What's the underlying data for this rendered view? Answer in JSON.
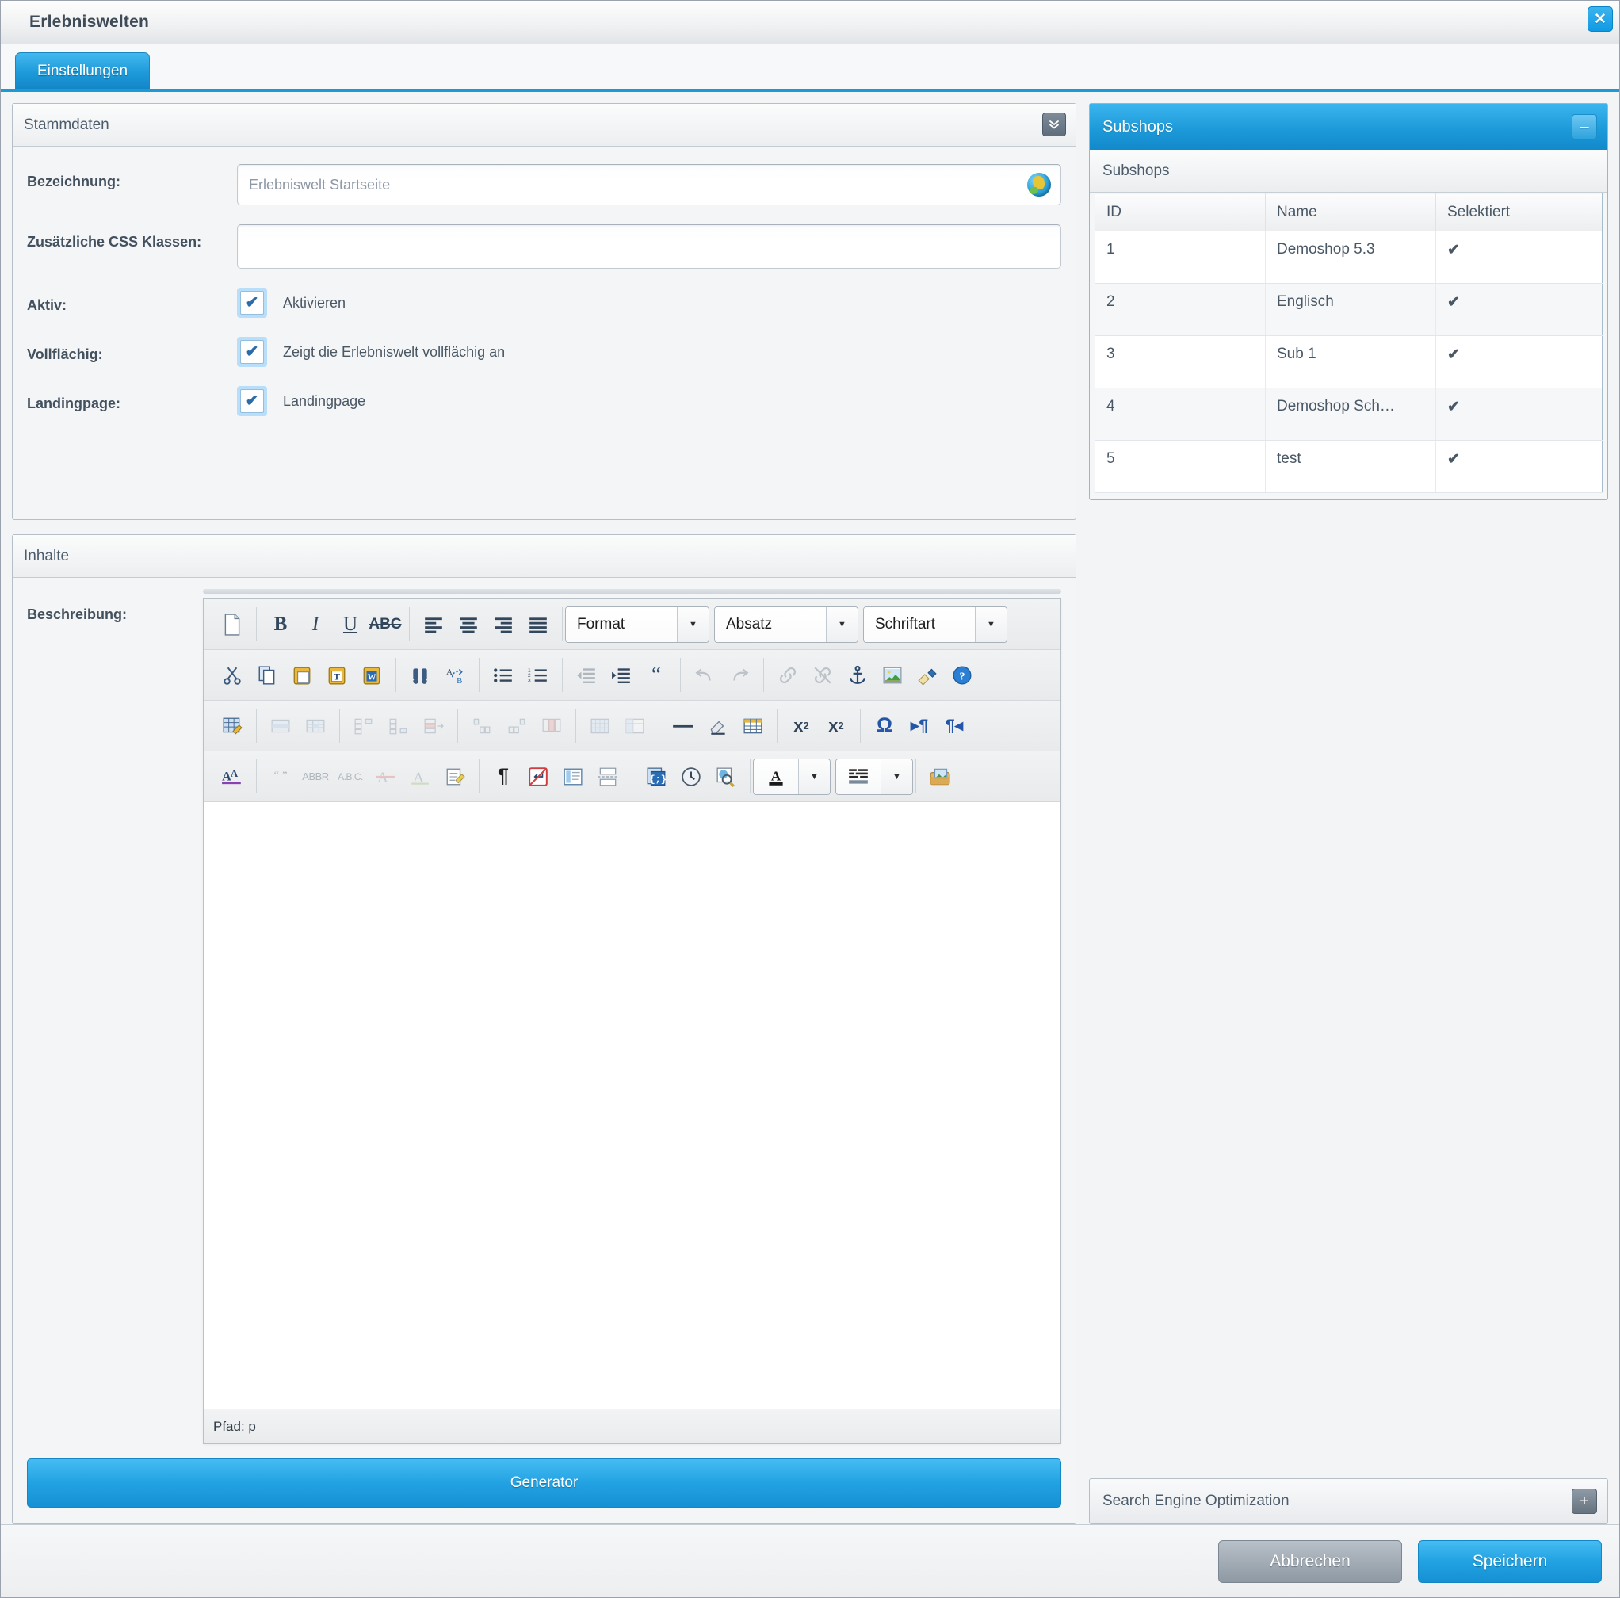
{
  "window": {
    "title": "Erlebniswelten",
    "close_icon": "close-icon"
  },
  "tabs": [
    {
      "label": "Einstellungen"
    }
  ],
  "stammdaten": {
    "header": "Stammdaten",
    "collapse_icon": "double-chevron-down-icon",
    "fields": {
      "bezeichnung_label": "Bezeichnung:",
      "bezeichnung_value": "Erlebniswelt Startseite",
      "css_label": "Zusätzliche CSS Klassen:",
      "css_value": "",
      "css_placeholder": "",
      "aktiv_label": "Aktiv:",
      "aktiv_checkbox_label": "Aktivieren",
      "vollflaechig_label": "Vollflächig:",
      "vollflaechig_checkbox_label": "Zeigt die Erlebniswelt vollflächig an",
      "landingpage_label": "Landingpage:",
      "landingpage_checkbox_label": "Landingpage",
      "check_glyph": "✔"
    }
  },
  "inhalte": {
    "header": "Inhalte",
    "beschreibung_label": "Beschreibung:",
    "editor": {
      "format_select": "Format",
      "absatz_select": "Absatz",
      "schriftart_select": "Schriftart",
      "status": "Pfad: p",
      "content": ""
    },
    "generator_button": "Generator"
  },
  "subshops": {
    "header": "Subshops",
    "collapse_icon": "minus-icon",
    "subheader": "Subshops",
    "columns": [
      "ID",
      "Name",
      "Selektiert"
    ],
    "rows": [
      {
        "id": "1",
        "name": "Demoshop 5.3",
        "selektiert": "✔"
      },
      {
        "id": "2",
        "name": "Englisch",
        "selektiert": "✔"
      },
      {
        "id": "3",
        "name": "Sub 1",
        "selektiert": "✔"
      },
      {
        "id": "4",
        "name": "Demoshop Sch…",
        "selektiert": "✔"
      },
      {
        "id": "5",
        "name": "test",
        "selektiert": "✔"
      }
    ]
  },
  "seo": {
    "label": "Search Engine Optimization",
    "expand_icon": "plus-icon"
  },
  "footer": {
    "cancel": "Abbrechen",
    "save": "Speichern"
  },
  "colors": {
    "accent": "#1d9ad9",
    "check_green": "#5aa734",
    "text": "#4a5866",
    "panel_bg": "#f4f5f6"
  }
}
